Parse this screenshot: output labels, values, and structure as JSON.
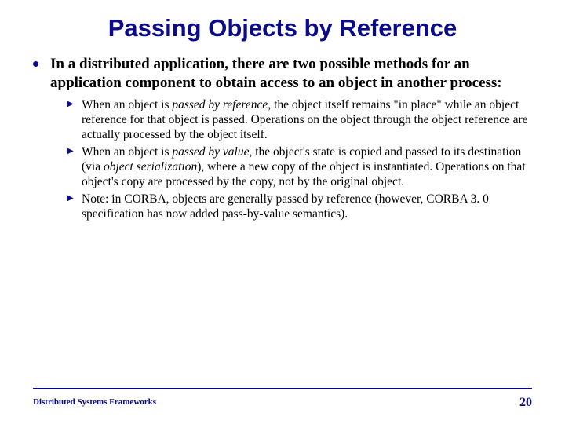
{
  "title": "Passing Objects by Reference",
  "intro": "In a distributed application, there are two possible methods for an application component to obtain access to an object in another process:",
  "bullets": [
    {
      "pre": "When an object is ",
      "em": "passed by reference",
      "post": ", the object itself remains \"in place\" while an object reference for that object is passed. Operations on the object through the object reference are actually processed by the object itself."
    },
    {
      "pre": "When an object is ",
      "em": "passed by value",
      "post1": ", the object's state is copied and passed to its destination (via ",
      "em2": "object serialization",
      "post2": "), where a new copy of the object is instantiated. Operations on that object's copy are processed by the copy, not by the original object."
    },
    {
      "text": "Note: in CORBA, objects are generally passed by reference (however, CORBA 3. 0 specification has now added pass-by-value semantics)."
    }
  ],
  "footer": {
    "left": "Distributed Systems Frameworks",
    "page": "20"
  }
}
